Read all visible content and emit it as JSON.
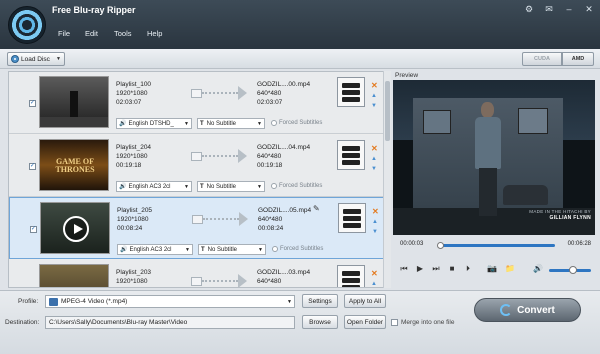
{
  "app": {
    "title": "Free Blu-ray Ripper"
  },
  "menu": [
    "File",
    "Edit",
    "Tools",
    "Help"
  ],
  "window_controls": [
    "settings-icon",
    "feedback-icon",
    "minimize-icon",
    "close-icon"
  ],
  "toolbar": {
    "load_disc": "Load Disc",
    "cuda": "CUDA",
    "amd": "AMD"
  },
  "rows": [
    {
      "name": "Playlist_100",
      "res": "1920*1080",
      "dur": "02:03:07",
      "out_name": "GODZIL....00.mp4",
      "out_res": "640*480",
      "out_dur": "02:03:07",
      "audio": "English DTSHD_",
      "subtitle": "No Subtitle",
      "forced": "Forced Subtitles"
    },
    {
      "name": "Playlist_204",
      "res": "1920*1080",
      "dur": "00:19:18",
      "out_name": "GODZIL....04.mp4",
      "out_res": "640*480",
      "out_dur": "00:19:18",
      "audio": "English AC3 2cl",
      "subtitle": "No Subtitle",
      "forced": "Forced Subtitles"
    },
    {
      "name": "Playlist_205",
      "res": "1920*1080",
      "dur": "00:08:24",
      "out_name": "GODZIL....05.mp4",
      "out_res": "640*480",
      "out_dur": "00:08:24",
      "audio": "English AC3 2cl",
      "subtitle": "No Subtitle",
      "forced": "Forced Subtitles"
    },
    {
      "name": "Playlist_203",
      "res": "1920*1080",
      "dur": "",
      "out_name": "GODZIL....03.mp4",
      "out_res": "640*480",
      "out_dur": "",
      "audio": "",
      "subtitle": "",
      "forced": ""
    }
  ],
  "preview": {
    "label": "Preview",
    "caption_line1": "MADE IN THE HITACHI BY",
    "caption_line2": "GILLIAN FLYNN",
    "time_current": "00:00:03",
    "time_total": "00:06:28"
  },
  "bottom": {
    "profile_label": "Profile:",
    "profile_value": "MPEG-4 Video (*.mp4)",
    "settings": "Settings",
    "apply_all": "Apply to All",
    "dest_label": "Destination:",
    "dest_value": "C:\\Users\\Sally\\Documents\\Blu-ray Master\\Video",
    "browse": "Browse",
    "open_folder": "Open Folder",
    "merge": "Merge into one file",
    "convert": "Convert"
  },
  "colors": {
    "accent": "#2e76c2",
    "titlebar": "#2f3b46",
    "remove": "#e37a1f"
  }
}
